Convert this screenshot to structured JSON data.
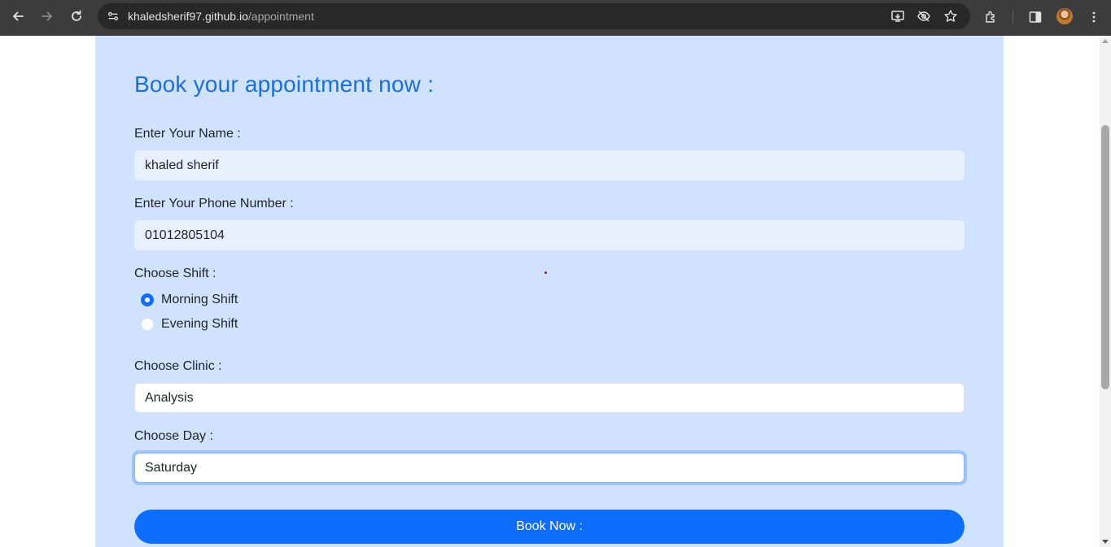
{
  "browser": {
    "url_host": "khaledsherif97.github.io",
    "url_path": "/appointment",
    "icons": [
      "back-icon",
      "forward-icon",
      "reload-icon",
      "site-info-icon",
      "install-app-icon",
      "tracking-eye-off-icon",
      "star-icon",
      "extensions-icon",
      "side-panel-icon",
      "profile-avatar",
      "menu-icon"
    ]
  },
  "form": {
    "title": "Book your appointment now :",
    "name_label": "Enter Your Name :",
    "name_value": "khaled sherif",
    "phone_label": "Enter Your Phone Number :",
    "phone_value": "01012805104",
    "shift_label": "Choose Shift :",
    "shift_options": [
      {
        "label": "Morning Shift",
        "checked": true
      },
      {
        "label": "Evening Shift",
        "checked": false
      }
    ],
    "clinic_label": "Choose Clinic :",
    "clinic_value": "Analysis",
    "day_label": "Choose Day :",
    "day_value": "Saturday",
    "submit_label": "Book Now :"
  },
  "colors": {
    "accent": "#0d6efd",
    "title": "#1a6fe0",
    "card_bg": "#cfe2ff",
    "chrome_bg": "#3c3c3c"
  }
}
